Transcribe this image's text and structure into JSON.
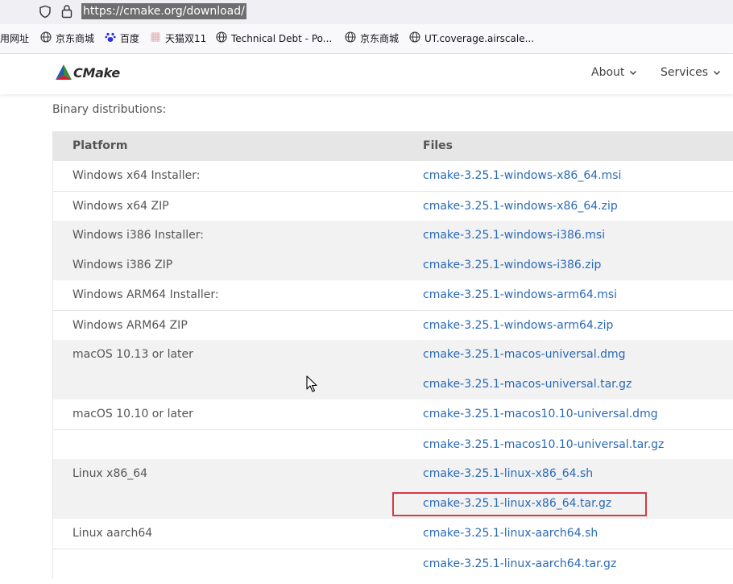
{
  "browser": {
    "url": "https://cmake.org/download/",
    "bookmarks": [
      {
        "label": "用网址",
        "icon": "none"
      },
      {
        "label": "京东商城",
        "icon": "globe-icon"
      },
      {
        "label": "百度",
        "icon": "baidu-paw-icon"
      },
      {
        "label": "天猫双11",
        "icon": "tmall-icon"
      },
      {
        "label": "Technical Debt - Po...",
        "icon": "globe-icon"
      },
      {
        "label": "京东商城",
        "icon": "globe-icon"
      },
      {
        "label": "UT.coverage.airscale...",
        "icon": "globe-icon"
      }
    ]
  },
  "header": {
    "logo": "CMake",
    "nav": [
      {
        "label": "About"
      },
      {
        "label": "Services"
      }
    ]
  },
  "content": {
    "intro": "Binary distributions:",
    "table": {
      "headers": {
        "platform": "Platform",
        "files": "Files"
      },
      "rows": [
        {
          "platform": "Windows x64 Installer:",
          "file": "cmake-3.25.1-windows-x86_64.msi"
        },
        {
          "platform": "Windows x64 ZIP",
          "file": "cmake-3.25.1-windows-x86_64.zip"
        },
        {
          "platform": "Windows i386 Installer:",
          "file": "cmake-3.25.1-windows-i386.msi"
        },
        {
          "platform": "Windows i386 ZIP",
          "file": "cmake-3.25.1-windows-i386.zip"
        },
        {
          "platform": "Windows ARM64 Installer:",
          "file": "cmake-3.25.1-windows-arm64.msi"
        },
        {
          "platform": "Windows ARM64 ZIP",
          "file": "cmake-3.25.1-windows-arm64.zip"
        },
        {
          "platform": "macOS 10.13 or later",
          "file": "cmake-3.25.1-macos-universal.dmg"
        },
        {
          "platform": "",
          "file": "cmake-3.25.1-macos-universal.tar.gz"
        },
        {
          "platform": "macOS 10.10 or later",
          "file": "cmake-3.25.1-macos10.10-universal.dmg"
        },
        {
          "platform": "",
          "file": "cmake-3.25.1-macos10.10-universal.tar.gz"
        },
        {
          "platform": "Linux x86_64",
          "file": "cmake-3.25.1-linux-x86_64.sh"
        },
        {
          "platform": "",
          "file": "cmake-3.25.1-linux-x86_64.tar.gz"
        },
        {
          "platform": "Linux aarch64",
          "file": "cmake-3.25.1-linux-aarch64.sh"
        },
        {
          "platform": "",
          "file": "cmake-3.25.1-linux-aarch64.tar.gz"
        }
      ]
    }
  },
  "colors": {
    "link": "#2a6ab6",
    "highlight_border": "#d63a45",
    "header_bg": "#e6e6e6",
    "shade_bg": "#f2f2f2"
  }
}
